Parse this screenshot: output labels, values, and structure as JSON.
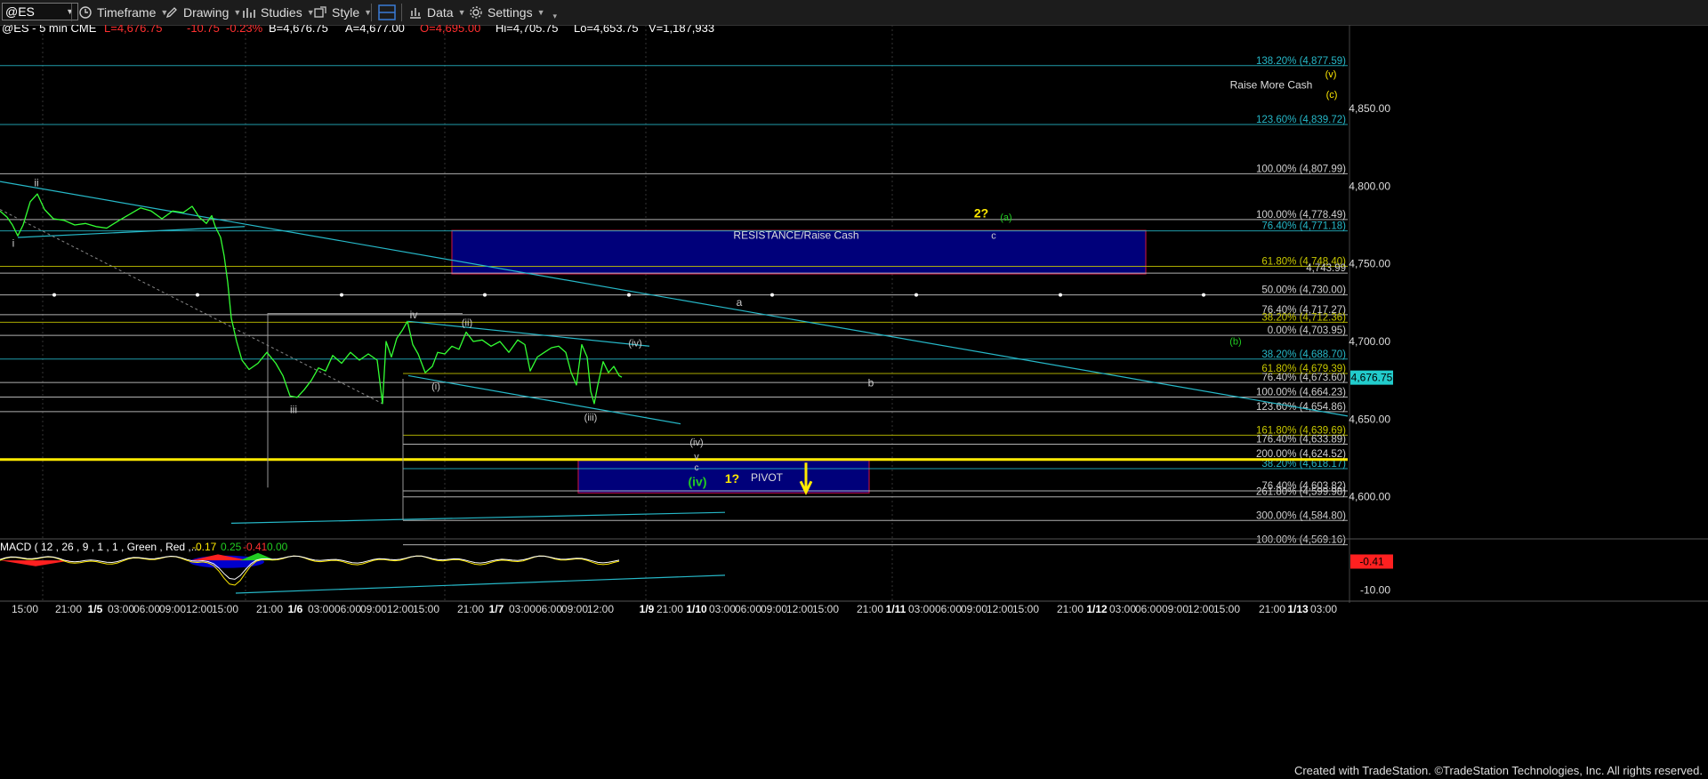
{
  "toolbar": {
    "symbol": "@ES",
    "timeframe": "Timeframe",
    "drawing": "Drawing",
    "studies": "Studies",
    "style": "Style",
    "data": "Data",
    "settings": "Settings"
  },
  "quote": {
    "symbol": "@ES - 5 min  CME",
    "last": "L=4,676.75",
    "change": "-10.75",
    "pct": "-0.23%",
    "bid": "B=4,676.75",
    "ask": "A=4,677.00",
    "open": "O=4,695.00",
    "high": "Hi=4,705.75",
    "low": "Lo=4,653.75",
    "volume": "V=1,187,933"
  },
  "colors": {
    "price": "#33ff33",
    "fib": "#d0d0d0",
    "trend": "#26b8c8",
    "zone_fill": "#00007a",
    "zone_border": "#b01040",
    "yellow": "#ffea00",
    "wave_green": "#22cc22",
    "last_price_bg": "#22cccc",
    "macd_red": "#ff2020"
  },
  "chart_data": {
    "type": "line",
    "title": "@ES - 5 min  CME",
    "ylim": [
      4565,
      4895
    ],
    "y_ticks": [
      "4,850.00",
      "4,800.00",
      "4,750.00",
      "4,700.00",
      "4,650.00",
      "4,600.00"
    ],
    "last_price": "4,676.75",
    "x_ticks": [
      "15:00",
      "21:00",
      "1/5",
      "03:00",
      "06:00",
      "09:00",
      "12:00",
      "15:00",
      "21:00",
      "1/6",
      "03:00",
      "06:00",
      "09:00",
      "12:00",
      "15:00",
      "21:00",
      "1/7",
      "03:00",
      "06:00",
      "09:00",
      "12:00",
      "1/9",
      "21:00",
      "1/10",
      "03:00",
      "06:00",
      "09:00",
      "12:00",
      "15:00",
      "21:00",
      "1/11",
      "03:00",
      "06:00",
      "09:00",
      "12:00",
      "15:00",
      "21:00",
      "1/12",
      "03:00",
      "06:00",
      "09:00",
      "12:00",
      "15:00",
      "21:00",
      "1/13",
      "03:00"
    ],
    "price_series": [
      {
        "x": 0,
        "y": 4784
      },
      {
        "x": 8,
        "y": 4780
      },
      {
        "x": 14,
        "y": 4775
      },
      {
        "x": 20,
        "y": 4768
      },
      {
        "x": 26,
        "y": 4775
      },
      {
        "x": 34,
        "y": 4790
      },
      {
        "x": 42,
        "y": 4795
      },
      {
        "x": 50,
        "y": 4785
      },
      {
        "x": 60,
        "y": 4779
      },
      {
        "x": 72,
        "y": 4778
      },
      {
        "x": 84,
        "y": 4775
      },
      {
        "x": 96,
        "y": 4776
      },
      {
        "x": 108,
        "y": 4774
      },
      {
        "x": 120,
        "y": 4773
      },
      {
        "x": 134,
        "y": 4778
      },
      {
        "x": 146,
        "y": 4782
      },
      {
        "x": 158,
        "y": 4786
      },
      {
        "x": 170,
        "y": 4784
      },
      {
        "x": 182,
        "y": 4779
      },
      {
        "x": 194,
        "y": 4784
      },
      {
        "x": 206,
        "y": 4783
      },
      {
        "x": 216,
        "y": 4787
      },
      {
        "x": 224,
        "y": 4780
      },
      {
        "x": 232,
        "y": 4776
      },
      {
        "x": 238,
        "y": 4781
      },
      {
        "x": 242,
        "y": 4774
      },
      {
        "x": 248,
        "y": 4767
      },
      {
        "x": 252,
        "y": 4755
      },
      {
        "x": 256,
        "y": 4738
      },
      {
        "x": 260,
        "y": 4715
      },
      {
        "x": 266,
        "y": 4700
      },
      {
        "x": 272,
        "y": 4688
      },
      {
        "x": 280,
        "y": 4682
      },
      {
        "x": 290,
        "y": 4686
      },
      {
        "x": 300,
        "y": 4693
      },
      {
        "x": 310,
        "y": 4686
      },
      {
        "x": 318,
        "y": 4678
      },
      {
        "x": 326,
        "y": 4665
      },
      {
        "x": 334,
        "y": 4664
      },
      {
        "x": 342,
        "y": 4669
      },
      {
        "x": 350,
        "y": 4675
      },
      {
        "x": 358,
        "y": 4683
      },
      {
        "x": 366,
        "y": 4681
      },
      {
        "x": 374,
        "y": 4691
      },
      {
        "x": 384,
        "y": 4686
      },
      {
        "x": 394,
        "y": 4693
      },
      {
        "x": 404,
        "y": 4688
      },
      {
        "x": 414,
        "y": 4692
      },
      {
        "x": 424,
        "y": 4688
      },
      {
        "x": 430,
        "y": 4660
      },
      {
        "x": 434,
        "y": 4700
      },
      {
        "x": 440,
        "y": 4690
      },
      {
        "x": 446,
        "y": 4702
      },
      {
        "x": 452,
        "y": 4707
      },
      {
        "x": 458,
        "y": 4713
      },
      {
        "x": 464,
        "y": 4698
      },
      {
        "x": 470,
        "y": 4692
      },
      {
        "x": 478,
        "y": 4680
      },
      {
        "x": 486,
        "y": 4684
      },
      {
        "x": 492,
        "y": 4693
      },
      {
        "x": 500,
        "y": 4692
      },
      {
        "x": 508,
        "y": 4697
      },
      {
        "x": 516,
        "y": 4695
      },
      {
        "x": 524,
        "y": 4706
      },
      {
        "x": 532,
        "y": 4700
      },
      {
        "x": 542,
        "y": 4701
      },
      {
        "x": 552,
        "y": 4697
      },
      {
        "x": 562,
        "y": 4700
      },
      {
        "x": 572,
        "y": 4693
      },
      {
        "x": 582,
        "y": 4701
      },
      {
        "x": 590,
        "y": 4698
      },
      {
        "x": 596,
        "y": 4681
      },
      {
        "x": 604,
        "y": 4690
      },
      {
        "x": 612,
        "y": 4693
      },
      {
        "x": 620,
        "y": 4696
      },
      {
        "x": 628,
        "y": 4697
      },
      {
        "x": 636,
        "y": 4693
      },
      {
        "x": 642,
        "y": 4680
      },
      {
        "x": 648,
        "y": 4672
      },
      {
        "x": 654,
        "y": 4698
      },
      {
        "x": 660,
        "y": 4690
      },
      {
        "x": 664,
        "y": 4668
      },
      {
        "x": 668,
        "y": 4660
      },
      {
        "x": 672,
        "y": 4672
      },
      {
        "x": 678,
        "y": 4687
      },
      {
        "x": 684,
        "y": 4680
      },
      {
        "x": 690,
        "y": 4684
      },
      {
        "x": 696,
        "y": 4678
      },
      {
        "x": 699,
        "y": 4677
      }
    ],
    "fib_levels": [
      {
        "label": "138.20% (4,877.59)",
        "y": 4877.59,
        "color": "#26b8c8"
      },
      {
        "label": "123.60% (4,839.72)",
        "y": 4839.72,
        "color": "#26b8c8"
      },
      {
        "label": "100.00% (4,807.99)",
        "y": 4807.99,
        "color": "#d0d0d0"
      },
      {
        "label": "100.00% (4,778.49)",
        "y": 4778.49,
        "color": "#d0d0d0"
      },
      {
        "label": "76.40% (4,771.18)",
        "y": 4771.18,
        "color": "#26b8c8"
      },
      {
        "label": "61.80% (4,748.40)",
        "y": 4748.4,
        "color": "#c8c800"
      },
      {
        "label": "4,743.99",
        "y": 4743.99,
        "color": "#d0d0d0"
      },
      {
        "label": "50.00% (4,730.00)",
        "y": 4730.0,
        "color": "#d0d0d0"
      },
      {
        "label": "76.40% (4,717.27)",
        "y": 4717.27,
        "color": "#d0d0d0"
      },
      {
        "label": "38.20% (4,712.36)",
        "y": 4712.36,
        "color": "#c8c800"
      },
      {
        "label": "0.00% (4,703.95)",
        "y": 4703.95,
        "color": "#d0d0d0"
      },
      {
        "label": "38.20% (4,688.70)",
        "y": 4688.7,
        "color": "#26b8c8"
      },
      {
        "label": "61.80% (4,679.39)",
        "y": 4679.39,
        "color": "#c8c800"
      },
      {
        "label": "76.40% (4,673.60)",
        "y": 4673.6,
        "color": "#d0d0d0"
      },
      {
        "label": "100.00% (4,664.23)",
        "y": 4664.23,
        "color": "#d0d0d0"
      },
      {
        "label": "123.60% (4,654.86)",
        "y": 4654.86,
        "color": "#d0d0d0"
      },
      {
        "label": "161.80% (4,639.69)",
        "y": 4639.69,
        "color": "#c8c800"
      },
      {
        "label": "176.40% (4,633.89)",
        "y": 4633.89,
        "color": "#d0d0d0"
      },
      {
        "label": "200.00% (4,624.52)",
        "y": 4624.52,
        "color": "#d0d0d0"
      },
      {
        "label": "38.20% (4,618.17)",
        "y": 4618.17,
        "color": "#26b8c8"
      },
      {
        "label": "76.40% (4,603.82)",
        "y": 4603.82,
        "color": "#d0d0d0"
      },
      {
        "label": "261.80% (4,599.98)",
        "y": 4599.98,
        "color": "#d0d0d0"
      },
      {
        "label": "300.00% (4,584.80)",
        "y": 4584.8,
        "color": "#d0d0d0"
      },
      {
        "label": "100.00% (4,569.16)",
        "y": 4569.16,
        "color": "#d0d0d0"
      }
    ],
    "zones": [
      {
        "label": "RESISTANCE/Raise Cash",
        "x0": 508,
        "x1": 1288,
        "y0": 4743.5,
        "y1": 4771.5
      },
      {
        "label": "PIVOT",
        "x0": 650,
        "x1": 977,
        "y0": 4602.5,
        "y1": 4623.5
      }
    ],
    "yellow_line": 4624.0,
    "annotations": {
      "raise_more_cash": "Raise More Cash",
      "wave_i": "i",
      "wave_ii": "ii",
      "wave_iii": "iii",
      "wave_iv": "iv",
      "wave_sub_i": "(i)",
      "wave_sub_ii": "(ii)",
      "wave_sub_iii": "(iii)",
      "wave_sub_iv": "(iv)",
      "wave_iv_lower": "(iv)",
      "wave_v": "v",
      "wave_c_lower": "c",
      "wave_iv_green": "(iv)",
      "one_q": "1?",
      "two_q": "2?",
      "wave_a_green": "(a)",
      "wave_c_upper": "c",
      "wave_a": "a",
      "wave_b": "b",
      "wave_b_green": "(b)",
      "wave_v_green": "(v)",
      "wave_c_green": "(c)"
    },
    "macd": {
      "label": "MACD ( 12 , 26 , 9 , 1 , 1 , Green , Red ,...",
      "v1": "-0.17",
      "v2": "0.25",
      "v3": "-0.41",
      "v4": "0.00",
      "ylim": [
        -12.5,
        6
      ],
      "y_ticks": [
        "-10.00"
      ],
      "last_value": "-0.41"
    }
  },
  "footer": {
    "credit": "Created with TradeStation. ©TradeStation Technologies, Inc. All rights reserved."
  }
}
